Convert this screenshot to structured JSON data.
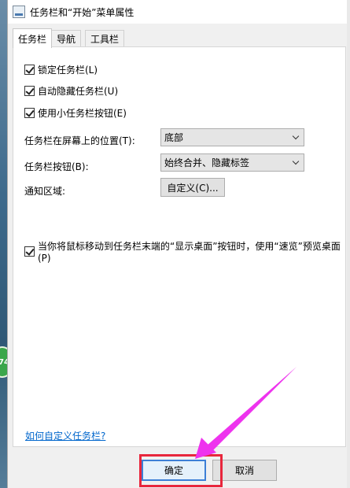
{
  "window": {
    "title": "任务栏和“开始”菜单属性"
  },
  "tabs": [
    {
      "label": "任务栏"
    },
    {
      "label": "导航"
    },
    {
      "label": "工具栏"
    }
  ],
  "taskbar": {
    "checkboxes": [
      {
        "label": "锁定任务栏(L)",
        "checked": true
      },
      {
        "label": "自动隐藏任务栏(U)",
        "checked": true
      },
      {
        "label": "使用小任务栏按钮(E)",
        "checked": true
      }
    ],
    "position": {
      "label": "任务栏在屏幕上的位置(T):",
      "value": "底部"
    },
    "buttons": {
      "label": "任务栏按钮(B):",
      "value": "始终合并、隐藏标签"
    },
    "notification": {
      "label": "通知区域:",
      "button": "自定义(C)..."
    },
    "peek": {
      "label": "当你将鼠标移动到任务栏末端的“显示桌面”按钮时，使用“速览”预览桌面(P)",
      "checked": true
    },
    "help_link": "如何自定义任务栏?"
  },
  "footer": {
    "ok": "确定",
    "cancel": "取消"
  },
  "desktop_badge": "74",
  "colors": {
    "highlight": "#e8263c",
    "arrow": "#ee33ee",
    "link": "#0066cc"
  }
}
